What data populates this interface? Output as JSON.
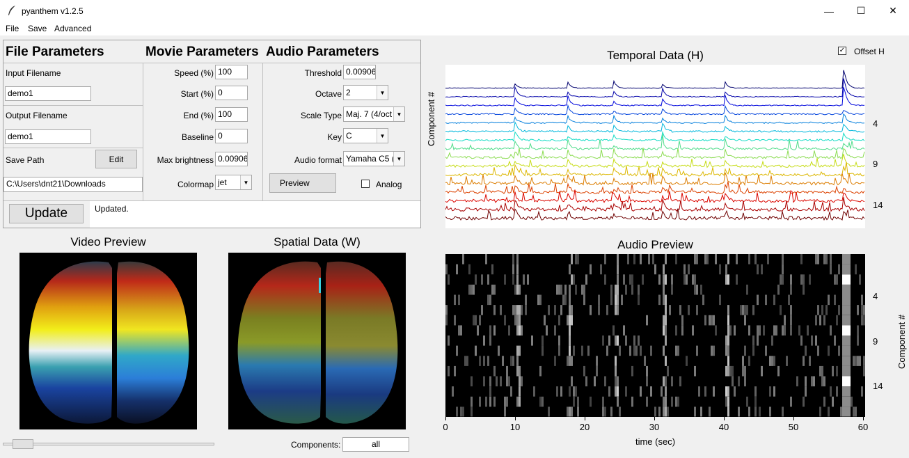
{
  "window": {
    "title": "pyanthem v1.2.5",
    "minimize": "—",
    "maximize": "☐",
    "close": "✕"
  },
  "menu": [
    "File",
    "Save",
    "Advanced"
  ],
  "file_params": {
    "header": "File Parameters",
    "input_label": "Input Filename",
    "input_value": "demo1",
    "output_label": "Output Filename",
    "output_value": "demo1",
    "save_path_label": "Save Path",
    "edit_button": "Edit",
    "save_path_value": "C:\\Users\\dnt21\\Downloads"
  },
  "movie_params": {
    "header": "Movie Parameters",
    "speed_label": "Speed (%)",
    "speed_value": "100",
    "start_label": "Start (%)",
    "start_value": "0",
    "end_label": "End (%)",
    "end_value": "100",
    "baseline_label": "Baseline",
    "baseline_value": "0",
    "max_brightness_label": "Max brightness",
    "max_brightness_value": "0.00906",
    "colormap_label": "Colormap",
    "colormap_value": "jet"
  },
  "audio_params": {
    "header": "Audio Parameters",
    "threshold_label": "Threshold",
    "threshold_value": "0.00906",
    "octave_label": "Octave",
    "octave_value": "2",
    "scale_label": "Scale Type",
    "scale_value": "Maj. 7 (4/oct",
    "key_label": "Key",
    "key_value": "C",
    "format_label": "Audio format",
    "format_value": "Yamaha C5 (",
    "preview_button": "Preview",
    "analog_label": "Analog",
    "analog_checked": false
  },
  "update": {
    "button": "Update",
    "status": "Updated."
  },
  "video_preview": {
    "title": "Video Preview",
    "slider_value": 0.05
  },
  "spatial": {
    "title": "Spatial Data (W)",
    "components_label": "Components:",
    "components_value": "all"
  },
  "temporal": {
    "title": "Temporal Data (H)",
    "offset_label": "Offset H",
    "offset_checked": true,
    "ylabel": "Component #",
    "yticks": [
      "4",
      "9",
      "14"
    ]
  },
  "audio_preview": {
    "title": "Audio Preview",
    "ylabel": "Component #",
    "xlabel": "time (sec)",
    "xticks": [
      "0",
      "10",
      "20",
      "30",
      "40",
      "50",
      "60"
    ],
    "yticks": [
      "4",
      "9",
      "14"
    ]
  },
  "chart_data": [
    {
      "type": "line",
      "title": "Temporal Data (H)",
      "ylabel": "Component #",
      "series_count": 16,
      "colormap": "jet",
      "x_range": [
        0,
        60
      ],
      "event_times_sec": [
        10,
        17.5,
        24,
        31,
        40,
        57
      ]
    },
    {
      "type": "heatmap",
      "title": "Audio Preview",
      "xlabel": "time (sec)",
      "ylabel": "Component #",
      "xlim": [
        0,
        60
      ],
      "rows": 16,
      "colors": {
        "background": "#000000",
        "on": "#ffffff"
      }
    }
  ],
  "colors": {
    "window_bg": "#f0f0f0",
    "panel_border": "#a0a0a0"
  }
}
